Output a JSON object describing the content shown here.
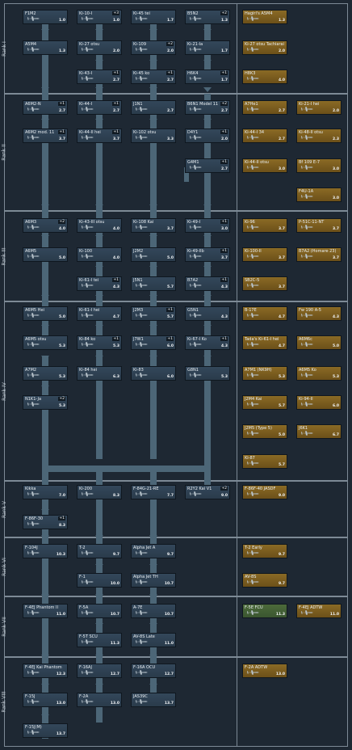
{
  "ranks": [
    "Rank I",
    "Rank II",
    "Rank III",
    "Rank IV",
    "Rank V",
    "Rank VI",
    "Rank VII",
    "Rank VIII"
  ],
  "vehicles": [
    {
      "name": "F1M2",
      "br": "1.0"
    },
    {
      "name": "Ki-10-I",
      "br": "1.0",
      "badge": "+3"
    },
    {
      "name": "Ki-45 tei",
      "br": "1.7"
    },
    {
      "name": "B5N2",
      "br": "1.3",
      "badge": "+2"
    },
    {
      "name": "Hagiri's A5M4",
      "br": "1.3"
    },
    {
      "name": "A5M4",
      "br": "1.3"
    },
    {
      "name": "Ki-27 otsu",
      "br": "2.0"
    },
    {
      "name": "Ki-109",
      "br": "2.0",
      "badge": "+2"
    },
    {
      "name": "Ki-21-Ia",
      "br": "1.7"
    },
    {
      "name": "Ki-27 otsu Tachiarai",
      "br": "2.0"
    },
    {
      "name": "Ki-43-I",
      "br": "2.7",
      "badge": "+1"
    },
    {
      "name": "Ki-45 ko",
      "br": "2.7",
      "badge": "+1"
    },
    {
      "name": "H6K4",
      "br": "1.7",
      "badge": "+1"
    },
    {
      "name": "H8K3",
      "br": "4.0"
    },
    {
      "name": "A6M2-N",
      "br": "2.7",
      "badge": "+1"
    },
    {
      "name": "Ki-44-I",
      "br": "2.7",
      "badge": "+1"
    },
    {
      "name": "J1N1",
      "br": "2.7"
    },
    {
      "name": "B6N1 Model 11",
      "br": "2.7",
      "badge": "+2"
    },
    {
      "name": "A7He1",
      "br": "2.7"
    },
    {
      "name": "Ki-21-I hei",
      "br": "2.0"
    },
    {
      "name": "A6M2 mod. 11",
      "br": "3.7",
      "badge": "+1"
    },
    {
      "name": "Ki-44-II hei",
      "br": "3.7",
      "badge": "+1"
    },
    {
      "name": "Ki-102 otsu",
      "br": "3.3"
    },
    {
      "name": "D4Y1",
      "br": "2.0",
      "badge": "+1"
    },
    {
      "name": "Ki-44-I 34",
      "br": "2.7"
    },
    {
      "name": "Ki-48-II otsu",
      "br": "2.3"
    },
    {
      "name": "G4M1",
      "br": "2.7",
      "badge": "+1"
    },
    {
      "name": "Ki-44-II otsu",
      "br": "3.0"
    },
    {
      "name": "Bf 109 E-7",
      "br": "3.0"
    },
    {
      "name": "F4U-1A",
      "br": "3.0"
    },
    {
      "name": "A6M3",
      "br": "4.0",
      "badge": "+2"
    },
    {
      "name": "Ki-43-III otsu",
      "br": "4.0"
    },
    {
      "name": "Ki-108 Kai",
      "br": "3.7"
    },
    {
      "name": "Ki-49-I",
      "br": "3.0",
      "badge": "+1"
    },
    {
      "name": "Ki-96",
      "br": "3.7"
    },
    {
      "name": "P-51C-11-NT",
      "br": "3.7"
    },
    {
      "name": "A6M5",
      "br": "5.0"
    },
    {
      "name": "Ki-100",
      "br": "4.0"
    },
    {
      "name": "J2M2",
      "br": "5.0"
    },
    {
      "name": "Ki-49-IIb",
      "br": "3.7",
      "badge": "+1"
    },
    {
      "name": "Ki-100-II",
      "br": "3.7"
    },
    {
      "name": "B7A2 (Homare 23)",
      "br": "3.7"
    },
    {
      "name": "Ki-61-I tei",
      "br": "4.3",
      "badge": "+1"
    },
    {
      "name": "J5N1",
      "br": "5.7"
    },
    {
      "name": "B7A2",
      "br": "4.3",
      "badge": "+1"
    },
    {
      "name": "SB2C-5",
      "br": "3.7"
    },
    {
      "name": "A6M5 Hei",
      "br": "5.0"
    },
    {
      "name": "Ki-61-I hei",
      "br": "4.7"
    },
    {
      "name": "J2M3",
      "br": "5.7",
      "badge": "+1"
    },
    {
      "name": "G5N1",
      "br": "4.3"
    },
    {
      "name": "B-17E",
      "br": "4.7"
    },
    {
      "name": "Fw 190 A-5",
      "br": "4.3"
    },
    {
      "name": "A6M5 otsu",
      "br": "5.3"
    },
    {
      "name": "Ki-84 ko",
      "br": "5.3",
      "badge": "+1"
    },
    {
      "name": "J7W1",
      "br": "6.0",
      "badge": "+1"
    },
    {
      "name": "Ki-67-I Ko",
      "br": "4.3",
      "badge": "+1"
    },
    {
      "name": "Tada's Ki-61-I hei",
      "br": "4.7"
    },
    {
      "name": "A6M6c",
      "br": "5.0"
    },
    {
      "name": "A7M2",
      "br": "5.3"
    },
    {
      "name": "Ki-84 hei",
      "br": "6.3"
    },
    {
      "name": "Ki-83",
      "br": "6.0"
    },
    {
      "name": "G8N1",
      "br": "5.3"
    },
    {
      "name": "A7M1 (NK9H)",
      "br": "5.3"
    },
    {
      "name": "A6M5 Ko",
      "br": "5.3"
    },
    {
      "name": "N1K1-Ja",
      "br": "5.3",
      "badge": "+2"
    },
    {
      "name": "J2M4 Kai",
      "br": "5.7"
    },
    {
      "name": "Ki-94-II",
      "br": "6.0"
    },
    {
      "name": "J2M5 (Type 5)",
      "br": "5.0"
    },
    {
      "name": "J6K1",
      "br": "6.7"
    },
    {
      "name": "Ki-87",
      "br": "5.7"
    },
    {
      "name": "Kikka",
      "br": "7.0"
    },
    {
      "name": "Ki-200",
      "br": "8.3"
    },
    {
      "name": "F-84G-21-RE",
      "br": "7.7"
    },
    {
      "name": "R2Y2 Kai V1",
      "br": "9.0",
      "badge": "+2"
    },
    {
      "name": "F-86F-40 JASDF",
      "br": "9.0"
    },
    {
      "name": "F-86F-30",
      "br": "8.3",
      "badge": "+1"
    },
    {
      "name": "F-104J",
      "br": "10.3"
    },
    {
      "name": "T-2",
      "br": "9.7"
    },
    {
      "name": "Alpha Jet A",
      "br": "9.7"
    },
    {
      "name": "T-2 Early",
      "br": "9.7"
    },
    {
      "name": "F-1",
      "br": "10.0"
    },
    {
      "name": "Alpha Jet TH",
      "br": "10.7"
    },
    {
      "name": "AV-8S",
      "br": "9.7"
    },
    {
      "name": "F-4EJ Phantom II",
      "br": "11.0"
    },
    {
      "name": "F-5A",
      "br": "10.7"
    },
    {
      "name": "A-7E",
      "br": "10.7"
    },
    {
      "name": "F-5E FCU",
      "br": "11.3"
    },
    {
      "name": "F-4EJ ADTW",
      "br": "11.0"
    },
    {
      "name": "F-5T SCU",
      "br": "11.3"
    },
    {
      "name": "AV-8S Late",
      "br": "11.0"
    },
    {
      "name": "F-4EJ Kai Phantom",
      "br": "12.3"
    },
    {
      "name": "F-16AJ",
      "br": "12.7"
    },
    {
      "name": "F-16A OCU",
      "br": "12.7"
    },
    {
      "name": "F-2A ADTW",
      "br": "13.0"
    },
    {
      "name": "F-15J",
      "br": "13.0"
    },
    {
      "name": "F-2A",
      "br": "13.0"
    },
    {
      "name": "JAS39C",
      "br": "13.7"
    },
    {
      "name": "F-15J(M)",
      "br": "13.7"
    }
  ]
}
